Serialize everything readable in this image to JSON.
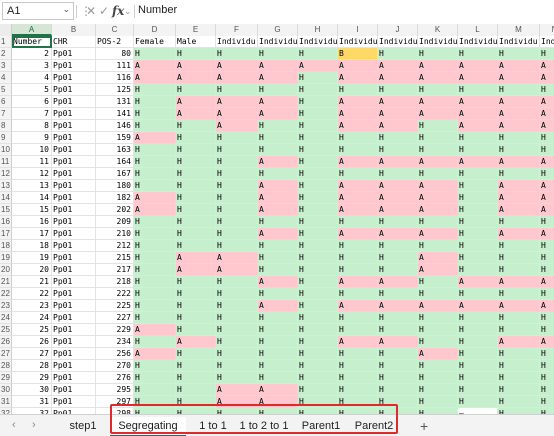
{
  "formula_bar": {
    "name_box": "A1",
    "name_box_arrow": "⌄",
    "more_icon": "⋮",
    "cancel_icon": "✕",
    "confirm_icon": "✓",
    "fx_label": "fx",
    "fx_arrow": "⌄",
    "value": "Number"
  },
  "columns": [
    "A",
    "B",
    "C",
    "D",
    "E",
    "F",
    "G",
    "H",
    "I",
    "J",
    "K",
    "L",
    "M",
    "N"
  ],
  "header_row": [
    "Number",
    "CHR",
    "POS-2",
    "Female",
    "Male",
    "Individu",
    "Individu",
    "Individu",
    "Individu",
    "Individu",
    "Individu",
    "Individu",
    "Individu",
    "Individu"
  ],
  "rows": [
    {
      "n": 2,
      "a": "2",
      "b": "Pp01",
      "c": "80",
      "g": [
        "H",
        "H",
        "H",
        "H",
        "H",
        "B",
        "H",
        "H",
        "H",
        "H"
      ]
    },
    {
      "n": 3,
      "a": "3",
      "b": "Pp01",
      "c": "111",
      "g": [
        "A",
        "A",
        "A",
        "A",
        "A",
        "A",
        "A",
        "A",
        "A",
        "A"
      ]
    },
    {
      "n": 4,
      "a": "4",
      "b": "Pp01",
      "c": "116",
      "g": [
        "A",
        "A",
        "A",
        "A",
        "H",
        "A",
        "A",
        "A",
        "A",
        "A"
      ]
    },
    {
      "n": 5,
      "a": "5",
      "b": "Pp01",
      "c": "125",
      "g": [
        "H",
        "H",
        "H",
        "H",
        "H",
        "H",
        "H",
        "H",
        "H",
        "H"
      ]
    },
    {
      "n": 6,
      "a": "6",
      "b": "Pp01",
      "c": "131",
      "g": [
        "H",
        "A",
        "A",
        "A",
        "H",
        "A",
        "A",
        "A",
        "A",
        "A"
      ]
    },
    {
      "n": 7,
      "a": "7",
      "b": "Pp01",
      "c": "141",
      "g": [
        "H",
        "A",
        "A",
        "A",
        "H",
        "A",
        "A",
        "A",
        "A",
        "A"
      ]
    },
    {
      "n": 8,
      "a": "8",
      "b": "Pp01",
      "c": "146",
      "g": [
        "H",
        "H",
        "A",
        "H",
        "H",
        "A",
        "A",
        "H",
        "A",
        "A"
      ]
    },
    {
      "n": 9,
      "a": "9",
      "b": "Pp01",
      "c": "159",
      "g": [
        "A",
        "H",
        "H",
        "H",
        "H",
        "H",
        "H",
        "H",
        "H",
        "H"
      ]
    },
    {
      "n": 10,
      "a": "10",
      "b": "Pp01",
      "c": "163",
      "g": [
        "H",
        "H",
        "H",
        "H",
        "H",
        "H",
        "H",
        "H",
        "H",
        "H"
      ]
    },
    {
      "n": 11,
      "a": "11",
      "b": "Pp01",
      "c": "164",
      "g": [
        "H",
        "H",
        "H",
        "A",
        "H",
        "A",
        "A",
        "A",
        "A",
        "A"
      ]
    },
    {
      "n": 12,
      "a": "12",
      "b": "Pp01",
      "c": "167",
      "g": [
        "H",
        "H",
        "H",
        "H",
        "H",
        "H",
        "H",
        "H",
        "H",
        "H"
      ]
    },
    {
      "n": 13,
      "a": "13",
      "b": "Pp01",
      "c": "180",
      "g": [
        "H",
        "H",
        "H",
        "A",
        "H",
        "A",
        "A",
        "A",
        "H",
        "A"
      ]
    },
    {
      "n": 14,
      "a": "14",
      "b": "Pp01",
      "c": "182",
      "g": [
        "A",
        "H",
        "H",
        "A",
        "H",
        "A",
        "A",
        "A",
        "H",
        "A"
      ]
    },
    {
      "n": 15,
      "a": "15",
      "b": "Pp01",
      "c": "202",
      "g": [
        "A",
        "H",
        "H",
        "A",
        "H",
        "A",
        "A",
        "A",
        "H",
        "A"
      ]
    },
    {
      "n": 16,
      "a": "16",
      "b": "Pp01",
      "c": "209",
      "g": [
        "H",
        "H",
        "H",
        "H",
        "H",
        "H",
        "H",
        "H",
        "H",
        "H"
      ]
    },
    {
      "n": 17,
      "a": "17",
      "b": "Pp01",
      "c": "210",
      "g": [
        "H",
        "H",
        "H",
        "A",
        "H",
        "A",
        "A",
        "A",
        "H",
        "A"
      ]
    },
    {
      "n": 18,
      "a": "18",
      "b": "Pp01",
      "c": "212",
      "g": [
        "H",
        "H",
        "H",
        "H",
        "H",
        "H",
        "H",
        "H",
        "H",
        "H"
      ]
    },
    {
      "n": 19,
      "a": "19",
      "b": "Pp01",
      "c": "215",
      "g": [
        "H",
        "A",
        "A",
        "H",
        "H",
        "H",
        "H",
        "A",
        "H",
        "H"
      ]
    },
    {
      "n": 20,
      "a": "20",
      "b": "Pp01",
      "c": "217",
      "g": [
        "H",
        "A",
        "A",
        "H",
        "H",
        "H",
        "H",
        "A",
        "H",
        "H"
      ]
    },
    {
      "n": 21,
      "a": "21",
      "b": "Pp01",
      "c": "218",
      "g": [
        "H",
        "H",
        "H",
        "A",
        "H",
        "A",
        "A",
        "H",
        "A",
        "A"
      ]
    },
    {
      "n": 22,
      "a": "22",
      "b": "Pp01",
      "c": "222",
      "g": [
        "H",
        "H",
        "H",
        "H",
        "H",
        "H",
        "H",
        "H",
        "H",
        "H"
      ]
    },
    {
      "n": 23,
      "a": "23",
      "b": "Pp01",
      "c": "225",
      "g": [
        "H",
        "H",
        "H",
        "A",
        "H",
        "A",
        "A",
        "A",
        "A",
        "A"
      ]
    },
    {
      "n": 24,
      "a": "24",
      "b": "Pp01",
      "c": "227",
      "g": [
        "H",
        "H",
        "H",
        "H",
        "H",
        "H",
        "H",
        "H",
        "H",
        "H"
      ]
    },
    {
      "n": 25,
      "a": "25",
      "b": "Pp01",
      "c": "229",
      "g": [
        "A",
        "H",
        "H",
        "H",
        "H",
        "H",
        "H",
        "H",
        "H",
        "H"
      ]
    },
    {
      "n": 26,
      "a": "26",
      "b": "Pp01",
      "c": "234",
      "g": [
        "H",
        "A",
        "H",
        "H",
        "H",
        "A",
        "A",
        "H",
        "H",
        "A"
      ]
    },
    {
      "n": 27,
      "a": "27",
      "b": "Pp01",
      "c": "256",
      "g": [
        "A",
        "H",
        "H",
        "H",
        "H",
        "H",
        "H",
        "A",
        "H",
        "H"
      ]
    },
    {
      "n": 28,
      "a": "28",
      "b": "Pp01",
      "c": "270",
      "g": [
        "H",
        "H",
        "H",
        "H",
        "H",
        "H",
        "H",
        "H",
        "H",
        "H"
      ]
    },
    {
      "n": 29,
      "a": "29",
      "b": "Pp01",
      "c": "276",
      "g": [
        "H",
        "H",
        "H",
        "H",
        "H",
        "H",
        "H",
        "H",
        "H",
        "H"
      ]
    },
    {
      "n": 30,
      "a": "30",
      "b": "Pp01",
      "c": "295",
      "g": [
        "H",
        "H",
        "A",
        "A",
        "H",
        "H",
        "H",
        "H",
        "H",
        "H"
      ]
    },
    {
      "n": 31,
      "a": "31",
      "b": "Pp01",
      "c": "297",
      "g": [
        "H",
        "H",
        "A",
        "A",
        "H",
        "H",
        "H",
        "H",
        "H",
        "H"
      ]
    },
    {
      "n": 32,
      "a": "32",
      "b": "Pp01",
      "c": "298",
      "g": [
        "H",
        "H",
        "H",
        "H",
        "H",
        "H",
        "H",
        "H",
        "–",
        "H"
      ]
    }
  ],
  "sheet_tabs": {
    "prev_icon": "‹",
    "next_icon": "›",
    "add_icon": "+",
    "tabs": [
      {
        "label": "step1",
        "active": false
      },
      {
        "label": "Segregating loci",
        "active": true
      },
      {
        "label": "1 to 1",
        "active": false
      },
      {
        "label": "1 to 2 to 1",
        "active": false
      },
      {
        "label": "Parent1",
        "active": false
      },
      {
        "label": "Parent2",
        "active": false
      }
    ]
  },
  "colors": {
    "green_fill": "#c6efce",
    "red_fill": "#ffc7ce",
    "yellow_fill": "#ffd966",
    "selection": "#217346",
    "callout_border": "#e0282e"
  }
}
